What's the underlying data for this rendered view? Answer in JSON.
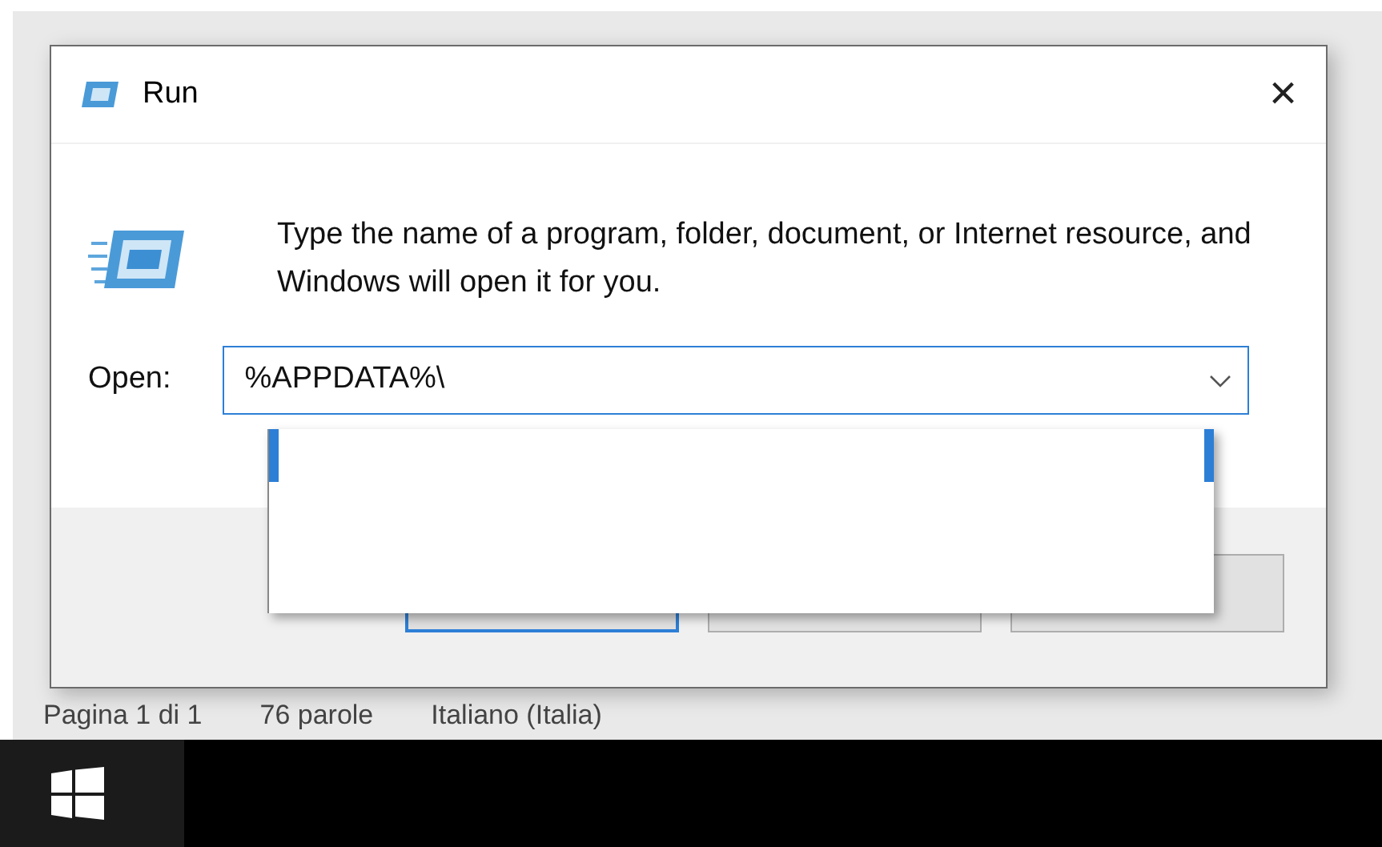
{
  "window": {
    "title": "Run",
    "close": "×"
  },
  "prompt": "Type the name of a program, folder, document, or Internet resource, and Windows will open it for you.",
  "open_field": {
    "label": "Open:",
    "value": "%APPDATA%\\",
    "dropdown_open": true
  },
  "buttons": [
    {
      "default": true
    },
    {
      "default": false
    },
    {
      "default": false
    }
  ],
  "status_bar": [
    "Pagina 1 di 1",
    "76 parole",
    "Italiano (Italia)"
  ]
}
